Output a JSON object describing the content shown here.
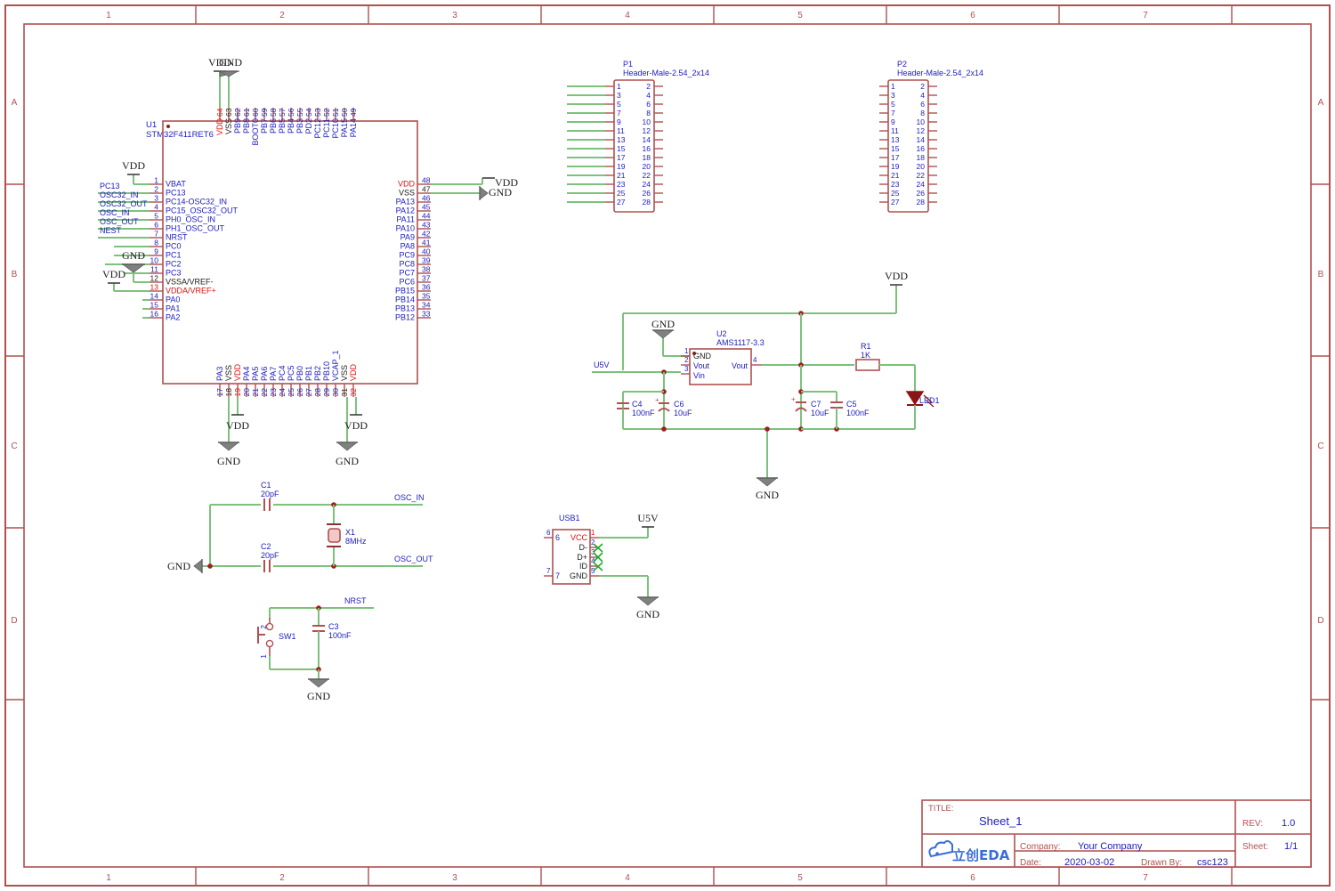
{
  "sheet": {
    "frame": {
      "columns": [
        "1",
        "2",
        "3",
        "4",
        "5",
        "6",
        "7"
      ],
      "rows": [
        "A",
        "B",
        "C",
        "D"
      ]
    },
    "colors": {
      "frame": "#b05050",
      "wire": "#7cc27c",
      "pin_body": "#b05050",
      "pin_number": "#2020c0",
      "pin_name": "#2020c0",
      "power_name": "#e01010",
      "gnd_name": "#202020",
      "netlabel": "#2020c0",
      "designator": "#2020c0",
      "symbol_text": "#202020",
      "junction": "#a02020",
      "nc_mark": "#22aa22",
      "logo": "#3a6fd8"
    }
  },
  "title_block": {
    "title_label": "TITLE:",
    "title_value": "Sheet_1",
    "rev_label": "REV:",
    "rev_value": "1.0",
    "company_label": "Company:",
    "company_value": "Your Company",
    "sheet_label": "Sheet:",
    "sheet_value": "1/1",
    "date_label": "Date:",
    "date_value": "2020-03-02",
    "drawn_label": "Drawn By:",
    "drawn_value": "csc123",
    "logo_text": "立创EDA"
  },
  "components": {
    "U1": {
      "designator": "U1",
      "value": "STM32F411RET6",
      "pins_left": [
        {
          "num": "1",
          "name": "VBAT",
          "type": "io"
        },
        {
          "num": "2",
          "name": "PC13",
          "type": "io"
        },
        {
          "num": "3",
          "name": "PC14-OSC32_IN",
          "type": "io"
        },
        {
          "num": "4",
          "name": "PC15_OSC32_OUT",
          "type": "io"
        },
        {
          "num": "5",
          "name": "PH0_OSC_IN",
          "type": "io"
        },
        {
          "num": "6",
          "name": "PH1_OSC_OUT",
          "type": "io"
        },
        {
          "num": "7",
          "name": "NRST",
          "type": "io"
        },
        {
          "num": "8",
          "name": "PC0",
          "type": "io"
        },
        {
          "num": "9",
          "name": "PC1",
          "type": "io"
        },
        {
          "num": "10",
          "name": "PC2",
          "type": "io"
        },
        {
          "num": "11",
          "name": "PC3",
          "type": "io"
        },
        {
          "num": "12",
          "name": "VSSA/VREF-",
          "type": "gnd"
        },
        {
          "num": "13",
          "name": "VDDA/VREF+",
          "type": "pwr"
        },
        {
          "num": "14",
          "name": "PA0",
          "type": "io"
        },
        {
          "num": "15",
          "name": "PA1",
          "type": "io"
        },
        {
          "num": "16",
          "name": "PA2",
          "type": "io"
        }
      ],
      "pins_right": [
        {
          "num": "48",
          "name": "VDD",
          "type": "pwr"
        },
        {
          "num": "47",
          "name": "VSS",
          "type": "gnd"
        },
        {
          "num": "46",
          "name": "PA13",
          "type": "io"
        },
        {
          "num": "45",
          "name": "PA12",
          "type": "io"
        },
        {
          "num": "44",
          "name": "PA11",
          "type": "io"
        },
        {
          "num": "43",
          "name": "PA10",
          "type": "io"
        },
        {
          "num": "42",
          "name": "PA9",
          "type": "io"
        },
        {
          "num": "41",
          "name": "PA8",
          "type": "io"
        },
        {
          "num": "40",
          "name": "PC9",
          "type": "io"
        },
        {
          "num": "39",
          "name": "PC8",
          "type": "io"
        },
        {
          "num": "38",
          "name": "PC7",
          "type": "io"
        },
        {
          "num": "37",
          "name": "PC6",
          "type": "io"
        },
        {
          "num": "36",
          "name": "PB15",
          "type": "io"
        },
        {
          "num": "35",
          "name": "PB14",
          "type": "io"
        },
        {
          "num": "34",
          "name": "PB13",
          "type": "io"
        },
        {
          "num": "33",
          "name": "PB12",
          "type": "io"
        }
      ],
      "pins_top": [
        {
          "num": "64",
          "name": "VDD",
          "type": "pwr"
        },
        {
          "num": "63",
          "name": "VSS",
          "type": "gnd"
        },
        {
          "num": "62",
          "name": "PB9",
          "type": "io"
        },
        {
          "num": "61",
          "name": "PB8",
          "type": "io"
        },
        {
          "num": "60",
          "name": "BOOT0",
          "type": "io"
        },
        {
          "num": "59",
          "name": "PB7",
          "type": "io"
        },
        {
          "num": "58",
          "name": "PB6",
          "type": "io"
        },
        {
          "num": "57",
          "name": "PB5",
          "type": "io"
        },
        {
          "num": "56",
          "name": "PB4",
          "type": "io"
        },
        {
          "num": "55",
          "name": "PB3",
          "type": "io"
        },
        {
          "num": "54",
          "name": "PD2",
          "type": "io"
        },
        {
          "num": "53",
          "name": "PC12",
          "type": "io"
        },
        {
          "num": "52",
          "name": "PC11",
          "type": "io"
        },
        {
          "num": "51",
          "name": "PC10",
          "type": "io"
        },
        {
          "num": "50",
          "name": "PA15",
          "type": "io"
        },
        {
          "num": "49",
          "name": "PA14",
          "type": "io"
        }
      ],
      "pins_bottom": [
        {
          "num": "17",
          "name": "PA3",
          "type": "io"
        },
        {
          "num": "18",
          "name": "VSS",
          "type": "gnd"
        },
        {
          "num": "19",
          "name": "VDD",
          "type": "pwr"
        },
        {
          "num": "20",
          "name": "PA4",
          "type": "io"
        },
        {
          "num": "21",
          "name": "PA5",
          "type": "io"
        },
        {
          "num": "22",
          "name": "PA6",
          "type": "io"
        },
        {
          "num": "23",
          "name": "PA7",
          "type": "io"
        },
        {
          "num": "24",
          "name": "PC4",
          "type": "io"
        },
        {
          "num": "25",
          "name": "PC5",
          "type": "io"
        },
        {
          "num": "26",
          "name": "PB0",
          "type": "io"
        },
        {
          "num": "27",
          "name": "PB1",
          "type": "io"
        },
        {
          "num": "28",
          "name": "PB2",
          "type": "io"
        },
        {
          "num": "29",
          "name": "PB10",
          "type": "io"
        },
        {
          "num": "30",
          "name": "VCAP_1",
          "type": "io"
        },
        {
          "num": "31",
          "name": "VSS",
          "type": "gnd"
        },
        {
          "num": "32",
          "name": "VDD",
          "type": "pwr"
        }
      ]
    },
    "U2": {
      "designator": "U2",
      "value": "AMS1117-3.3",
      "pins_left": [
        {
          "num": "1",
          "name": "GND"
        },
        {
          "num": "2",
          "name": "Vout"
        },
        {
          "num": "3",
          "name": "Vin"
        }
      ],
      "pins_right": [
        {
          "num": "4",
          "name": "Vout"
        }
      ]
    },
    "USB1": {
      "designator": "USB1",
      "pins_left": [
        {
          "num": "6",
          "name": "6"
        },
        {
          "num": "7",
          "name": "7"
        }
      ],
      "pins_right": [
        {
          "num": "1",
          "name": "VCC",
          "nc": false
        },
        {
          "num": "2",
          "name": "D-",
          "nc": true
        },
        {
          "num": "3",
          "name": "D+",
          "nc": true
        },
        {
          "num": "4",
          "name": "ID",
          "nc": true
        },
        {
          "num": "5",
          "name": "GND",
          "nc": false
        }
      ]
    },
    "P1": {
      "designator": "P1",
      "value": "Header-Male-2.54_2x14",
      "pin_count": 28,
      "left_wires": true
    },
    "P2": {
      "designator": "P2",
      "value": "Header-Male-2.54_2x14",
      "pin_count": 28,
      "left_wires": false
    },
    "X1": {
      "designator": "X1",
      "value": "8MHz"
    },
    "C1": {
      "designator": "C1",
      "value": "20pF"
    },
    "C2": {
      "designator": "C2",
      "value": "20pF"
    },
    "C3": {
      "designator": "C3",
      "value": "100nF"
    },
    "C4": {
      "designator": "C4",
      "value": "100nF"
    },
    "C5": {
      "designator": "C5",
      "value": "100nF"
    },
    "C6": {
      "designator": "C6",
      "value": "10uF"
    },
    "C7": {
      "designator": "C7",
      "value": "10uF"
    },
    "R1": {
      "designator": "R1",
      "value": "1K"
    },
    "LED1": {
      "designator": "LED1"
    },
    "SW1": {
      "designator": "SW1",
      "pin1": "1",
      "pin2": "2"
    }
  },
  "net_labels": {
    "pc13": "PC13",
    "osc32_in": "OSC32_IN",
    "osc32_out": "OSC32_OUT",
    "osc_in_left": "OSC_IN",
    "osc_out_left": "OSC_OUT",
    "nest": "NEST",
    "osc_in_xtal": "OSC_IN",
    "osc_out_xtal": "OSC_OUT",
    "nrst": "NRST",
    "u5v_reg": "U5V",
    "u5v_usb": "U5V"
  },
  "power_symbols": {
    "vdd": "VDD",
    "gnd": "GND"
  }
}
